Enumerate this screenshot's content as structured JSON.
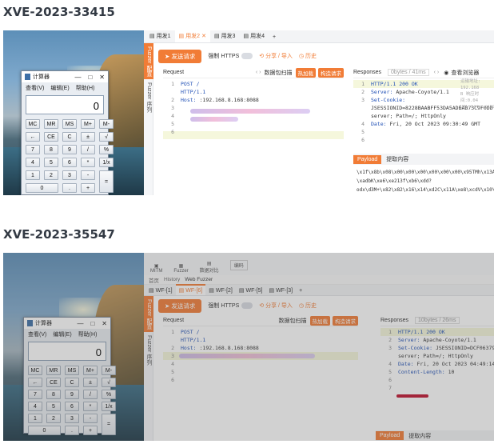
{
  "sections": [
    {
      "title": "XVE-2023-33415",
      "calculator": {
        "title": "计算器",
        "menu": [
          "查看(V)",
          "编辑(E)",
          "帮助(H)"
        ],
        "display": "0",
        "keys": [
          "MC",
          "MR",
          "MS",
          "M+",
          "M-",
          "←",
          "CE",
          "C",
          "±",
          "√",
          "7",
          "8",
          "9",
          "/",
          "%",
          "4",
          "5",
          "6",
          "*",
          "1/x",
          "1",
          "2",
          "3",
          "-",
          "=",
          "0",
          ".",
          "+"
        ]
      },
      "app": {
        "tabs": [
          "用发1",
          "用发2",
          "用发3",
          "用发4",
          "+"
        ],
        "rail": [
          "Fuzzer 配置",
          "Fuzzer 序列"
        ],
        "send_label": "发送请求",
        "https_label": "强制 HTTPS",
        "share_label": "分享 / 导入",
        "history_label": "历史",
        "request": {
          "label": "Request",
          "scan_label": "数据包扫描",
          "hot_label": "热加载",
          "build_label": "构造请求",
          "lines": [
            {
              "n": "1",
              "text": "POST /"
            },
            {
              "n": "",
              "text": "HTTP/1.1"
            },
            {
              "n": "2",
              "text": "Host:  :192.168.8.168:8088"
            },
            {
              "n": "3",
              "text": ""
            },
            {
              "n": "4",
              "text": ""
            },
            {
              "n": "5",
              "text": ""
            },
            {
              "n": "6",
              "text": ""
            }
          ]
        },
        "response": {
          "label": "Responses",
          "meta": "0bytes / 41ms",
          "browser_label": "查看浏览器",
          "side_notes": [
            "运输地址: 192.168",
            "B 响应时间:0.04",
            "URL:http://192"
          ],
          "lines": [
            {
              "n": "1",
              "text": "HTTP/1.1 200 OK"
            },
            {
              "n": "2",
              "text": "Server: Apache-Coyote/1.1"
            },
            {
              "n": "3",
              "text": "Set-Cookie:"
            },
            {
              "n": "",
              "text": "JSESSIONID=8228BAABFF53DA5ADBAB73C9F0DD"
            },
            {
              "n": "",
              "text": "server; Path=/; HttpOnly"
            },
            {
              "n": "4",
              "text": "Date: Fri, 20 Oct 2023 09:30:49 GMT"
            },
            {
              "n": "5",
              "text": ""
            },
            {
              "n": "6",
              "text": ""
            }
          ],
          "payload_tab": "Payload",
          "extract_tab": "提取内容",
          "payload_lines": [
            "\\x1f\\x8b\\x08\\x00\\x00\\x00\\x00\\x00\\x00\\x95TMh\\x13A",
            "\\xadbK\\xe6\\xe213f\\xb6\\xdd?",
            "odx\\d3M+\\x82\\x82\\x16\\x14\\xd2C\\x11A\\xe8\\xcdV\\x10\\x0f"
          ]
        }
      }
    },
    {
      "title": "XVE-2023-35547",
      "calculator": {
        "title": "计算器",
        "menu": [
          "查看(V)",
          "编辑(E)",
          "帮助(H)"
        ],
        "display": "0",
        "keys": [
          "MC",
          "MR",
          "MS",
          "M+",
          "M-",
          "←",
          "CE",
          "C",
          "±",
          "√",
          "7",
          "8",
          "9",
          "/",
          "%",
          "4",
          "5",
          "6",
          "*",
          "1/x",
          "1",
          "2",
          "3",
          "-",
          "=",
          "0",
          ".",
          "+"
        ]
      },
      "app": {
        "top_icons": [
          "MITM",
          "Fuzzer",
          "数据对比",
          "编码"
        ],
        "nav": [
          "首页",
          "History",
          "Web Fuzzer"
        ],
        "tabs": [
          "WF-[1]",
          "WF-[6]",
          "WF-[2]",
          "WF-[5]",
          "WF-[3]",
          "+"
        ],
        "rail": [
          "Fuzzer 配置",
          "Fuzzer 序列"
        ],
        "send_label": "发送请求",
        "https_label": "强制 HTTPS",
        "share_label": "分享 / 导入",
        "history_label": "历史",
        "request": {
          "label": "Request",
          "scan_label": "数据包扫描",
          "hot_label": "热加载",
          "build_label": "构造请求",
          "lines": [
            {
              "n": "1",
              "text": "POST /"
            },
            {
              "n": "",
              "text": "HTTP/1.1"
            },
            {
              "n": "2",
              "text": "Host:  :192.168.8.168:8088"
            },
            {
              "n": "3",
              "text": ""
            },
            {
              "n": "4",
              "text": ""
            },
            {
              "n": "5",
              "text": ""
            },
            {
              "n": "6",
              "text": ""
            }
          ]
        },
        "response": {
          "label": "Responses",
          "meta": "10bytes / 26ms",
          "lines": [
            {
              "n": "1",
              "text": "HTTP/1.1 200 OK"
            },
            {
              "n": "2",
              "text": "Server: Apache-Coyote/1.1"
            },
            {
              "n": "3",
              "text": "Set-Cookie: JSESSIONID=DCF06379904"
            },
            {
              "n": "",
              "text": "server; Path=/; HttpOnly"
            },
            {
              "n": "4",
              "text": "Date: Fri, 20 Oct 2023 04:49:14 GMT"
            },
            {
              "n": "5",
              "text": "Content-Length: 10"
            },
            {
              "n": "6",
              "text": ""
            },
            {
              "n": "7",
              "text": ""
            }
          ],
          "payload_tab": "Payload",
          "extract_tab": "提取内容"
        }
      }
    }
  ],
  "colors": {
    "accent": "#f17c36",
    "code_blue": "#1f4fb5",
    "heading": "#333a44"
  }
}
